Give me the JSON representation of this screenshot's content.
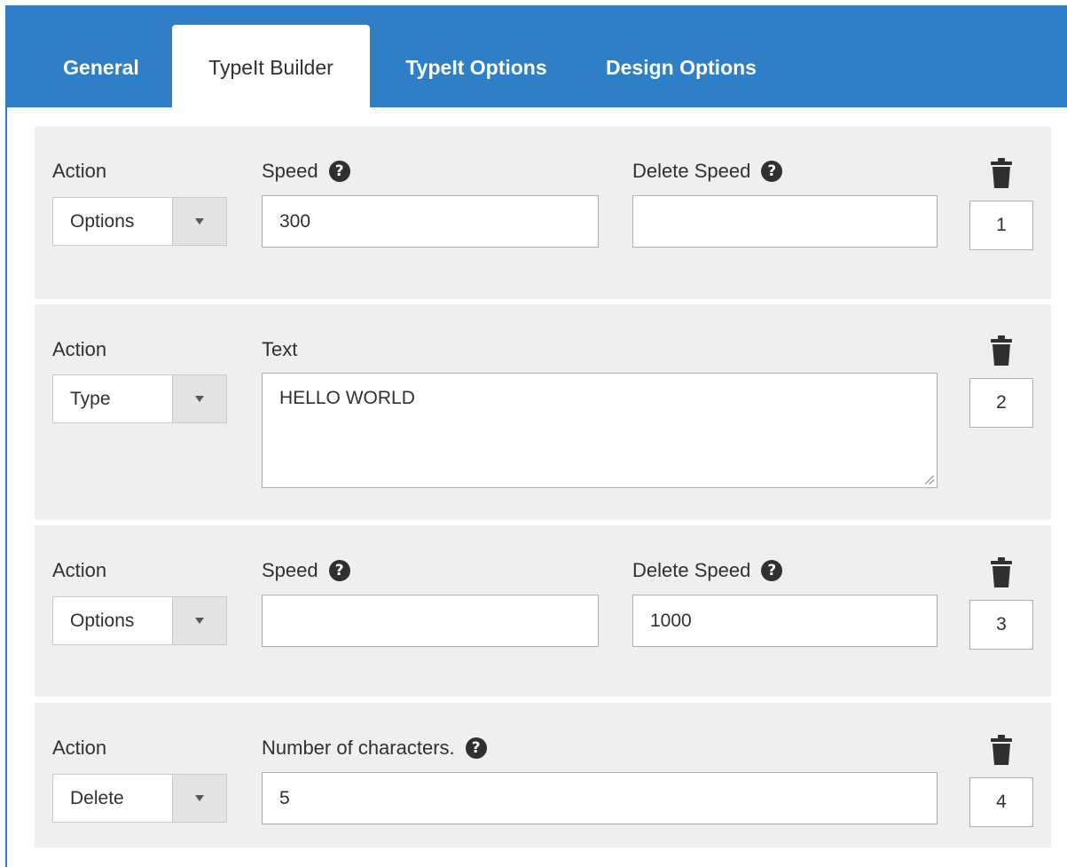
{
  "tabs": [
    {
      "label": "General"
    },
    {
      "label": "TypeIt Builder"
    },
    {
      "label": "TypeIt Options"
    },
    {
      "label": "Design Options"
    }
  ],
  "icons": {
    "help": "question-circle-icon",
    "trash": "trash-icon",
    "dropdown": "chevron-down-icon",
    "help_glyph": "?"
  },
  "colors": {
    "tab_bar": "#2f7fc6",
    "panel": "#efefef",
    "text": "#303030"
  },
  "rows": [
    {
      "action_label": "Action",
      "action_value": "Options",
      "field1_label": "Speed",
      "field1_value": "300",
      "field2_label": "Delete Speed",
      "field2_value": "",
      "order": "1"
    },
    {
      "action_label": "Action",
      "action_value": "Type",
      "text_label": "Text",
      "text_value": "HELLO WORLD",
      "order": "2"
    },
    {
      "action_label": "Action",
      "action_value": "Options",
      "field1_label": "Speed",
      "field1_value": "",
      "field2_label": "Delete Speed",
      "field2_value": "1000",
      "order": "3"
    },
    {
      "action_label": "Action",
      "action_value": "Delete",
      "field1_label": "Number of characters.",
      "field1_value": "5",
      "order": "4"
    }
  ]
}
